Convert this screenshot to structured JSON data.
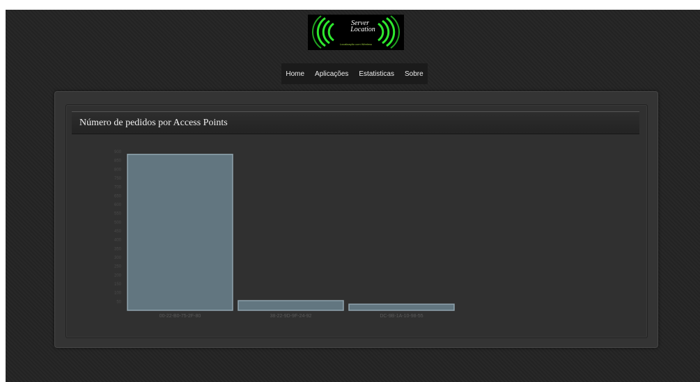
{
  "logo": {
    "line1": "Server",
    "line2": "Location",
    "tagline": "Localização com Wireless"
  },
  "nav": {
    "items": [
      "Home",
      "Aplicações",
      "Estatisticas",
      "Sobre"
    ]
  },
  "panel": {
    "title": "Número de pedidos por Access Points"
  },
  "colors": {
    "bar_fill": "#627680",
    "bar_stroke": "#8fa3ad",
    "logo_green": "#2ee82e"
  },
  "chart_data": {
    "type": "bar",
    "categories": [
      "00-22-B0-75-2F-80",
      "38-22-9D-9F-24-92",
      "DC-9B-1A-10-98-55"
    ],
    "values": [
      885,
      55,
      35
    ],
    "ylim": [
      0,
      900
    ],
    "yticks": [
      50,
      100,
      150,
      200,
      250,
      300,
      350,
      400,
      450,
      500,
      550,
      600,
      650,
      700,
      750,
      800,
      850,
      900
    ],
    "title": "",
    "xlabel": "",
    "ylabel": "",
    "grid": false
  }
}
